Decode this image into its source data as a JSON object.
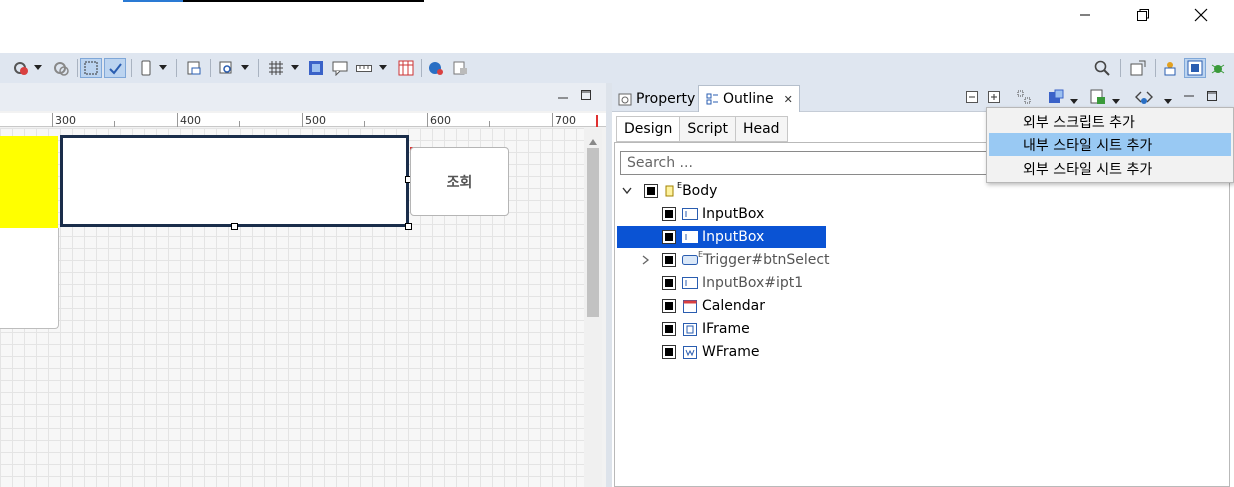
{
  "window": {
    "minimize_icon": "minimize-icon",
    "restore_icon": "restore-icon",
    "close_icon": "close-icon"
  },
  "editor": {
    "ruler": [
      "300",
      "400",
      "500",
      "600",
      "700"
    ],
    "button_label": "조회"
  },
  "panel": {
    "tabs": [
      "Property",
      "Outline"
    ],
    "subtabs": [
      "Design",
      "Script",
      "Head"
    ],
    "search_placeholder": "Search ..."
  },
  "tree": {
    "root": {
      "label": "Body",
      "badge": "E"
    },
    "children": [
      {
        "label": "InputBox"
      },
      {
        "label": "InputBox"
      },
      {
        "label": "Trigger#btnSelect",
        "badge": "E"
      },
      {
        "label": "InputBox#ipt1"
      },
      {
        "label": "Calendar"
      },
      {
        "label": "IFrame"
      },
      {
        "label": "WFrame"
      }
    ]
  },
  "context_menu": {
    "items": [
      "외부 스크립트 추가",
      "내부 스타일 시트 추가",
      "외부 스타일 시트 추가"
    ],
    "highlighted_index": 1
  },
  "colors": {
    "selection": "#0a53d4",
    "menu_highlight": "#99c9f3",
    "yellow_block": "#ffff00",
    "toolbar_bg": "#dfe6f0"
  }
}
